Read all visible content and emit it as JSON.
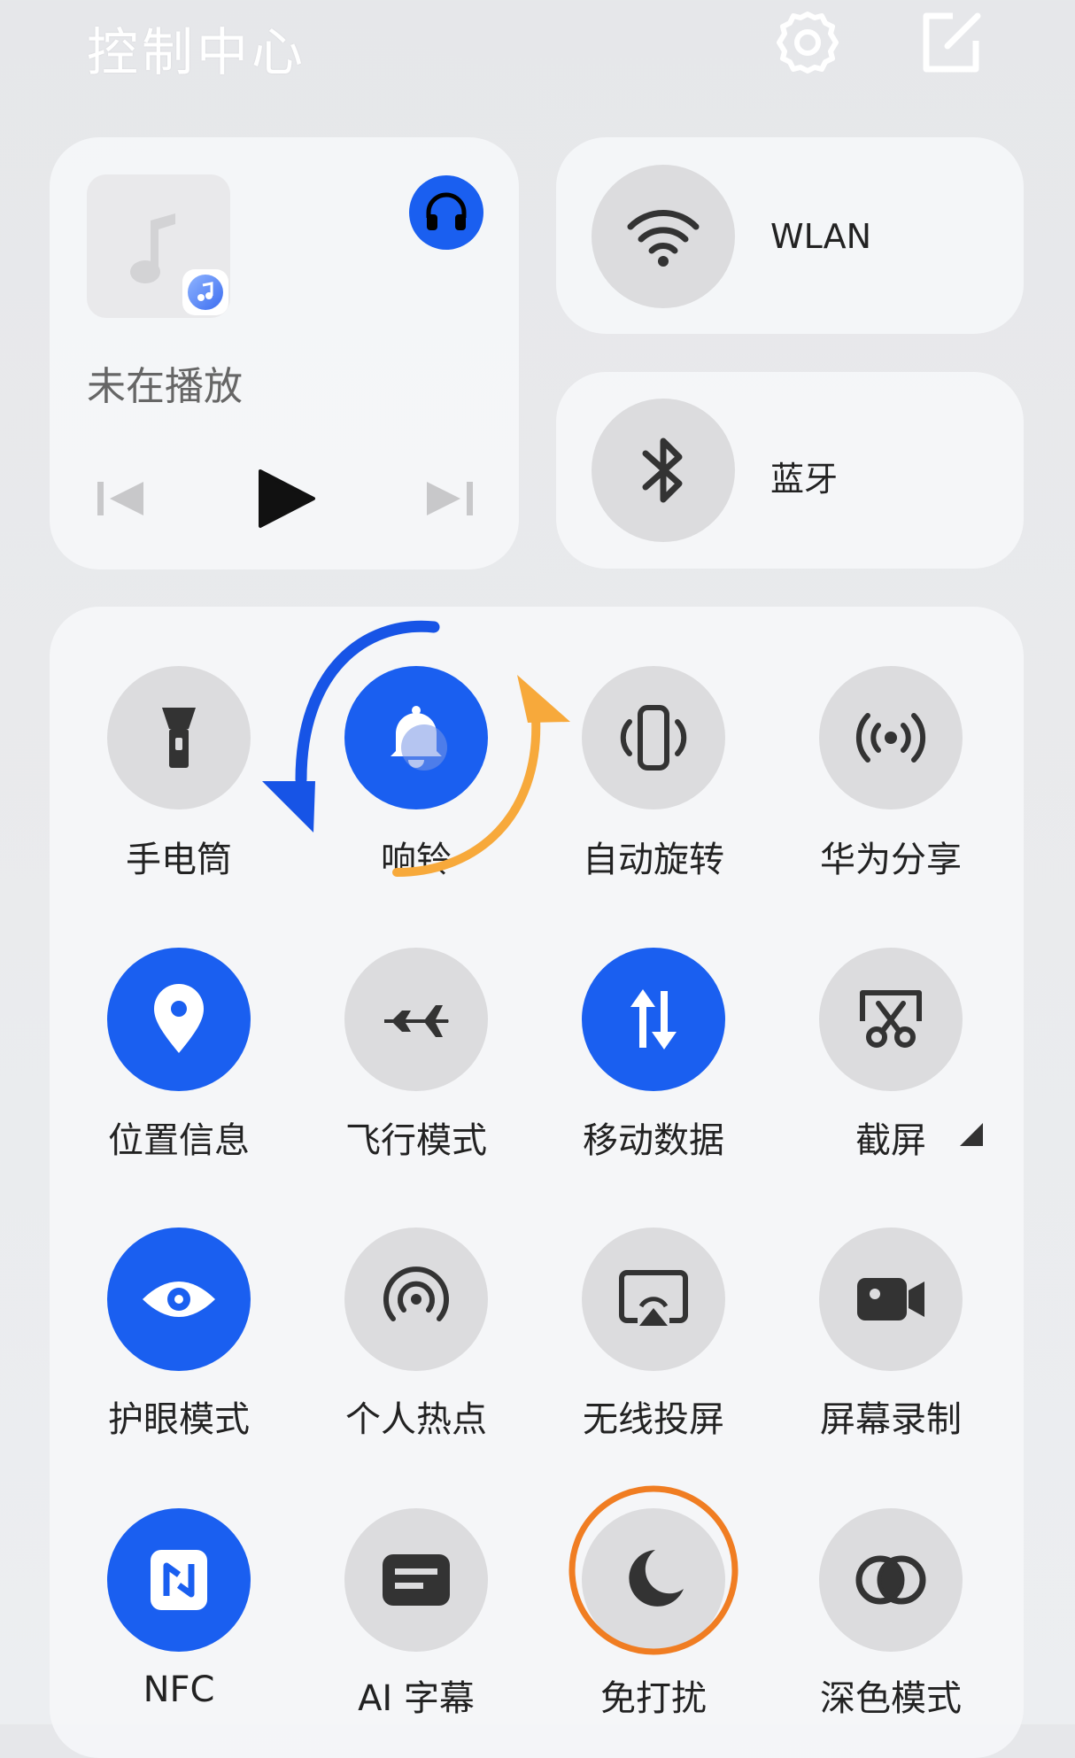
{
  "header": {
    "title": "控制中心",
    "icons": [
      "settings-gear-icon",
      "edit-icon"
    ]
  },
  "media": {
    "status": "未在播放",
    "icons": [
      "music-note-icon",
      "music-app-icon",
      "headphones-icon",
      "previous-icon",
      "play-icon",
      "next-icon"
    ],
    "accent": "#1a5ff0"
  },
  "connectivity": [
    {
      "label": "WLAN",
      "icon": "wifi-icon"
    },
    {
      "label": "蓝牙",
      "icon": "bluetooth-icon"
    }
  ],
  "toggles": [
    {
      "label": "手电筒",
      "icon": "flashlight-icon",
      "on": false
    },
    {
      "label": "响铃",
      "icon": "bell-icon",
      "on": true
    },
    {
      "label": "自动旋转",
      "icon": "auto-rotate-icon",
      "on": false
    },
    {
      "label": "华为分享",
      "icon": "share-icon",
      "on": false
    },
    {
      "label": "位置信息",
      "icon": "location-pin-icon",
      "on": true
    },
    {
      "label": "飞行模式",
      "icon": "airplane-icon",
      "on": false
    },
    {
      "label": "移动数据",
      "icon": "mobile-data-icon",
      "on": true
    },
    {
      "label": "截屏",
      "icon": "screenshot-scissors-icon",
      "on": false
    },
    {
      "label": "护眼模式",
      "icon": "eye-icon",
      "on": true
    },
    {
      "label": "个人热点",
      "icon": "hotspot-icon",
      "on": false
    },
    {
      "label": "无线投屏",
      "icon": "screen-cast-icon",
      "on": false
    },
    {
      "label": "屏幕录制",
      "icon": "screen-record-icon",
      "on": false
    },
    {
      "label": "NFC",
      "icon": "nfc-icon",
      "on": true
    },
    {
      "label": "AI 字幕",
      "icon": "ai-caption-icon",
      "on": false
    },
    {
      "label": "免打扰",
      "icon": "moon-icon",
      "on": false
    },
    {
      "label": "深色模式",
      "icon": "dark-mode-icon",
      "on": false
    }
  ],
  "annotations": {
    "swap_arrows": [
      "blue-curved-arrow",
      "orange-curved-arrow"
    ],
    "highlight": "orange-circle-highlight",
    "colors": {
      "blue": "#1754e6",
      "orange": "#f7a93b",
      "highlight": "#f07d22"
    }
  }
}
